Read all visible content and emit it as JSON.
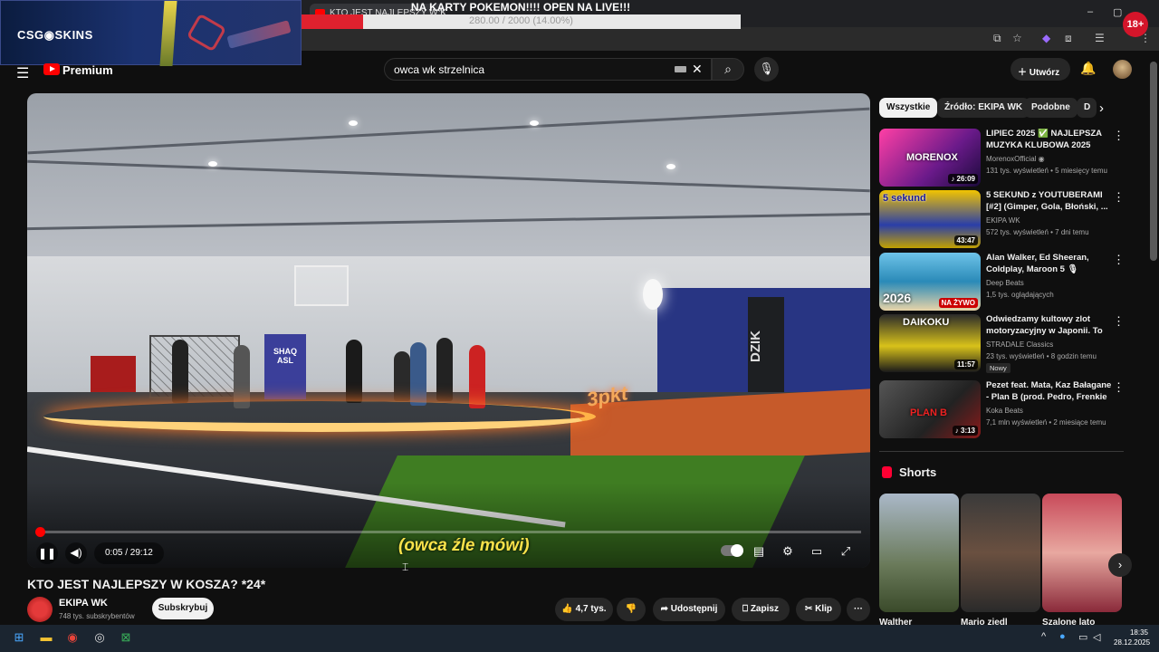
{
  "browser": {
    "tab_title": "KTO JEST NAJLEPSZY W K",
    "tab_close": "×"
  },
  "overlay": {
    "sponsor": "CSG◉SKINS",
    "banner": "NA KARTY POKEMON!!!! OPEN NA LIVE!!!",
    "goal_text": "280.00 / 2000 (14.00%)",
    "goal_progress": 0.14,
    "age_badge": "18+"
  },
  "header": {
    "logo_text": "Premium",
    "search_value": "owca wk strzelnica",
    "create_label": "Utwórz"
  },
  "video": {
    "time": "0:05 / 29:12",
    "progress": 0.003,
    "subtitle": "(owca źle mówi)",
    "overlay_text": "3pkt",
    "sign_text": "DZIK",
    "banner_text": "SHAQ ASL"
  },
  "meta": {
    "title": "KTO JEST NAJLEPSZY W KOSZA? *24*",
    "channel": "EKIPA WK",
    "subscribers": "748 tys. subskrybentów",
    "subscribe": "Subskrybuj",
    "likes": "4,7 tys.",
    "share": "Udostępnij",
    "save": "Zapisz",
    "clip": "Klip"
  },
  "chips": [
    "Wszystkie",
    "Źródło: EKIPA WK",
    "Podobne",
    "D"
  ],
  "recs": [
    {
      "title": "LIPIEC 2025 ✅ NAJLEPSZA MUZYKA KLUBOWA 2025 VOL...",
      "channel": "MorenoxOfficial ◉",
      "meta": "131 tys. wyświetleń • 5 miesięcy temu",
      "duration": "♪ 26:09",
      "thumb_text": "MORENOX"
    },
    {
      "title": "5 SEKUND z YOUTUBERAMI [#2] (Gimper, Gola, Błoński, ...",
      "channel": "EKIPA WK",
      "meta": "572 tys. wyświetleń • 7 dni temu",
      "duration": "43:47",
      "thumb_text": "5 sekund"
    },
    {
      "title": "Alan Walker, Ed Sheeran, Coldplay, Maroon 5 🎙 Música...",
      "channel": "Deep Beats",
      "meta": "1,5 tys. oglądających",
      "duration": "NA ŻYWO",
      "thumb_text": "2026"
    },
    {
      "title": "Odwiedzamy kultowy zlot motoryzacyjny w Japonii. To j...",
      "channel": "STRADALE Classics",
      "meta": "23 tys. wyświetleń • 8 godzin temu",
      "duration": "11:57",
      "thumb_text": "DAIKOKU",
      "badge": "Nowy"
    },
    {
      "title": "Pezet feat. Mata, Kaz Bałagane - Plan B (prod. Pedro, Frenkie G)",
      "channel": "Koka Beats",
      "meta": "7,1 mln wyświetleń • 2 miesiące temu",
      "duration": "♪ 3:13",
      "thumb_text": "PLAN B"
    }
  ],
  "shorts": {
    "title": "Shorts",
    "items": [
      {
        "label": "Walther"
      },
      {
        "label": "Mario ziedl"
      },
      {
        "label": "Szalone lato"
      }
    ]
  },
  "taskbar": {
    "time": "18:35",
    "date": "28.12.2025"
  },
  "colors": {
    "accent": "#ff0000",
    "background": "#0f0f0f",
    "chip": "#272727"
  }
}
